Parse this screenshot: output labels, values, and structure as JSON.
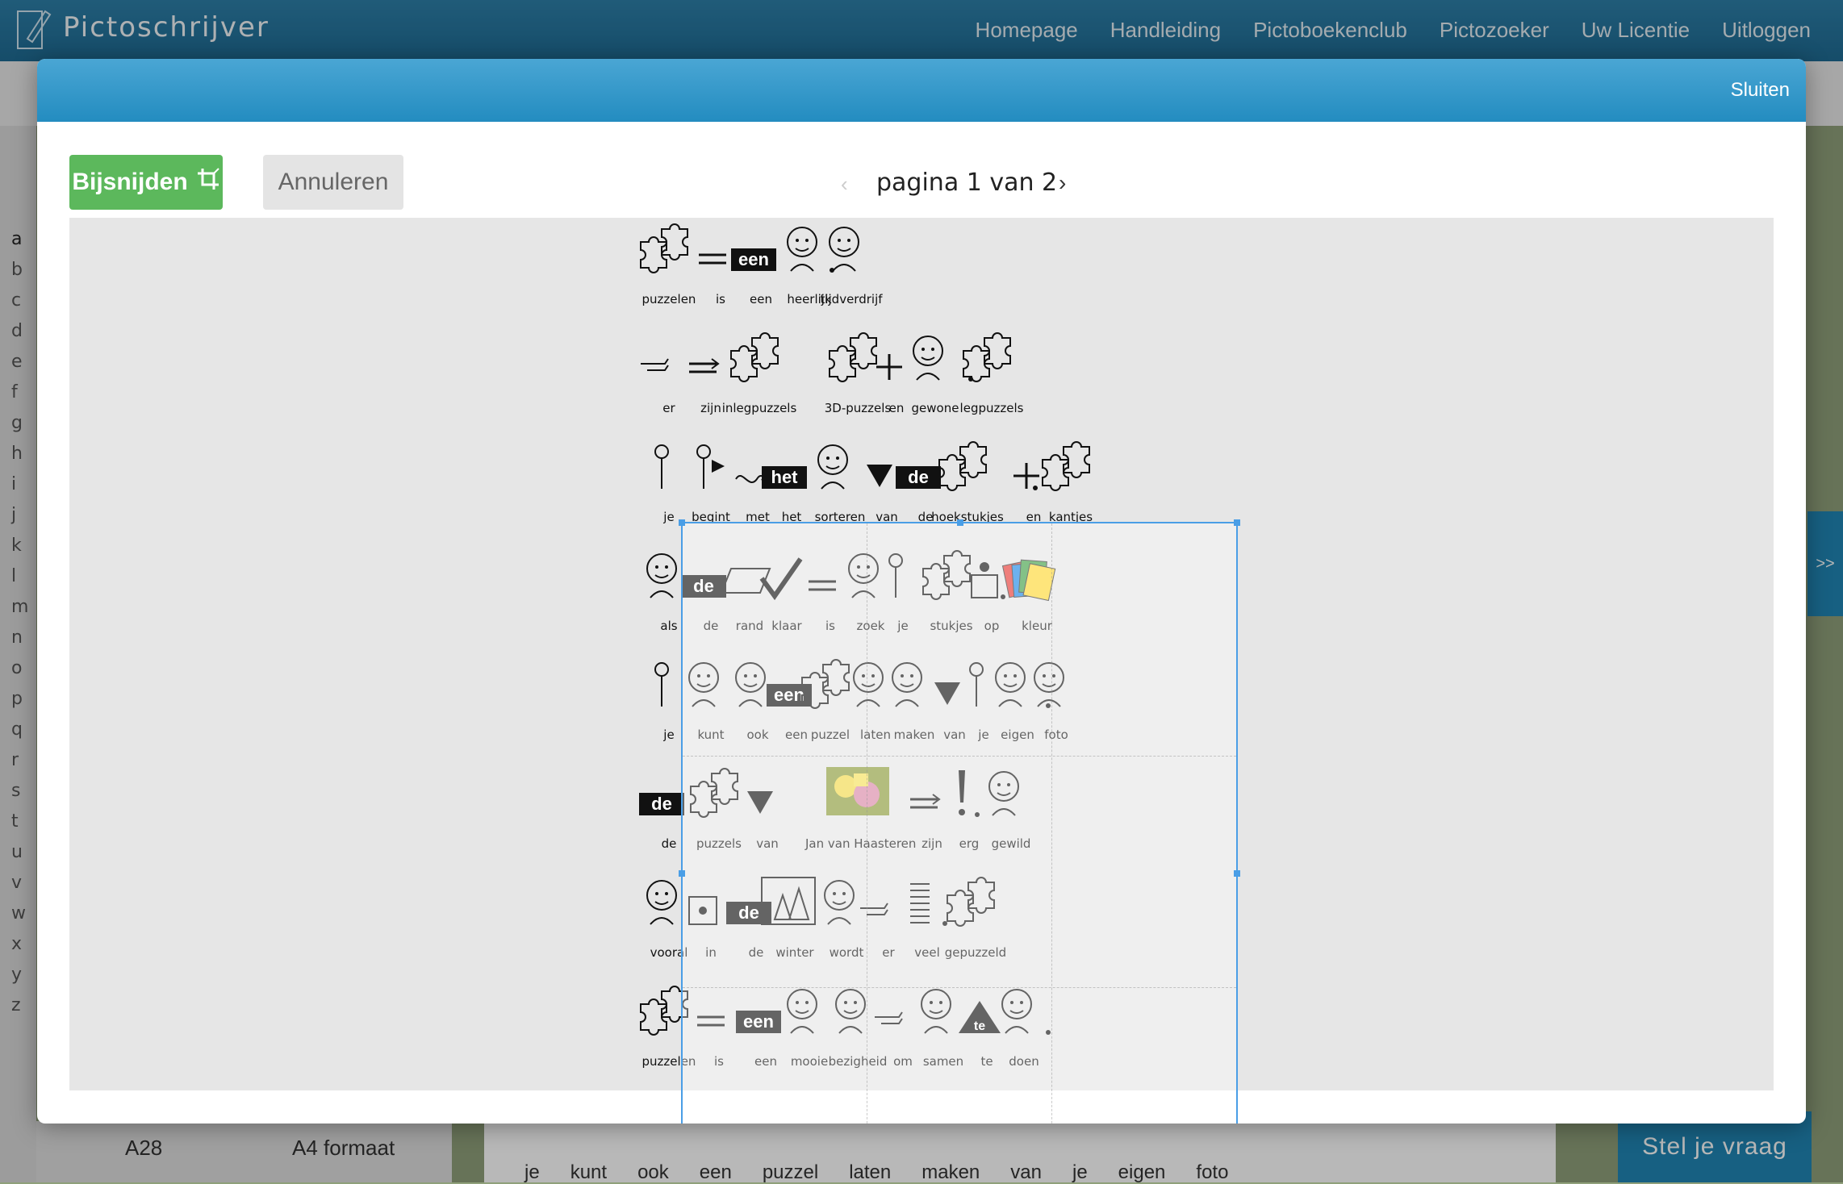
{
  "app": {
    "title": "Pictoschrijver",
    "nav": [
      "Homepage",
      "Handleiding",
      "Pictoboekenclub",
      "Pictozoeker",
      "Uw Licentie",
      "Uitloggen"
    ]
  },
  "alphabet": [
    "a",
    "b",
    "c",
    "d",
    "e",
    "f",
    "g",
    "h",
    "i",
    "j",
    "k",
    "l",
    "m",
    "n",
    "o",
    "p",
    "q",
    "r",
    "s",
    "t",
    "u",
    "v",
    "w",
    "x",
    "y",
    "z"
  ],
  "background": {
    "a28": "A28",
    "a4": "A4 formaat",
    "words": [
      "je",
      "kunt",
      "ook",
      "een",
      "puzzel",
      "laten",
      "maken",
      "van",
      "je",
      "eigen",
      "foto"
    ],
    "ask_button": "Stel je vraag",
    "side_tab": ">>"
  },
  "modal": {
    "close_label": "Sluiten",
    "crop_button": "Bijsnijden",
    "cancel_button": "Annuleren",
    "pager": {
      "label": "pagina 1 van 2",
      "prev": "‹",
      "next": "›"
    }
  },
  "sentences": [
    [
      "puzzelen",
      "is",
      "een",
      "heerlijk",
      "tijdverdrijf"
    ],
    [
      "er",
      "zijn",
      "inlegpuzzels",
      "3D-puzzels",
      "en",
      "gewone",
      "legpuzzels"
    ],
    [
      "je",
      "begint",
      "met",
      "het",
      "sorteren",
      "van",
      "de",
      "hoekstukjes",
      "en",
      "kantjes"
    ],
    [
      "als",
      "de",
      "rand",
      "klaar",
      "is",
      "zoek",
      "je",
      "stukjes",
      "op",
      "kleur"
    ],
    [
      "je",
      "kunt",
      "ook",
      "een",
      "puzzel",
      "laten",
      "maken",
      "van",
      "je",
      "eigen",
      "foto"
    ],
    [
      "de",
      "puzzels",
      "van",
      "Jan van Haasteren",
      "zijn",
      "erg",
      "gewild"
    ],
    [
      "vooral",
      "in",
      "de",
      "winter",
      "wordt",
      "er",
      "veel",
      "gepuzzeld"
    ],
    [
      "puzzelen",
      "is",
      "een",
      "mooie",
      "bezigheid",
      "om",
      "samen",
      "te",
      "doen"
    ]
  ],
  "badges": {
    "een": "een",
    "het": "het",
    "de": "de",
    "te": "te"
  },
  "colors": {
    "accent": "#2186b4",
    "crop_green": "#5cb85c",
    "selection": "#4a9ee6"
  }
}
